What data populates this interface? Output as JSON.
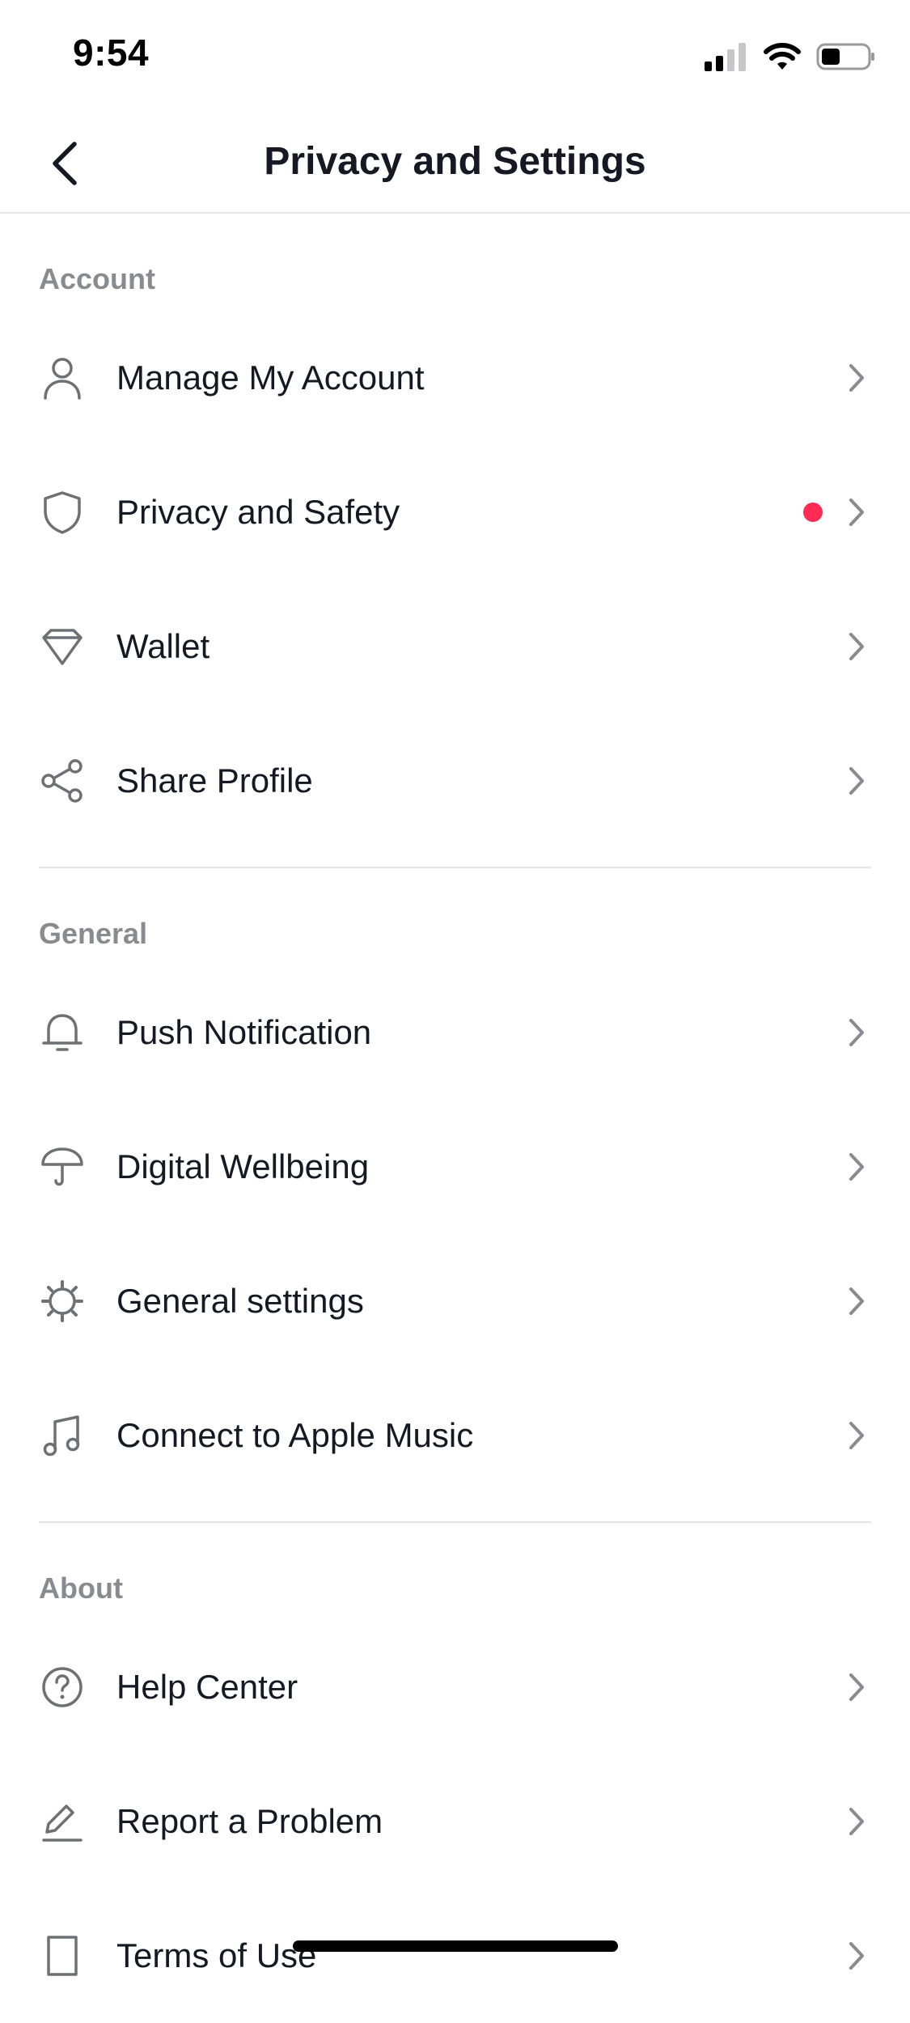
{
  "status_bar": {
    "time": "9:54"
  },
  "nav": {
    "title": "Privacy and Settings"
  },
  "sections": {
    "account": {
      "header": "Account",
      "items": [
        {
          "label": "Manage My Account",
          "icon": "person-icon"
        },
        {
          "label": "Privacy and Safety",
          "icon": "shield-icon",
          "has_notification_dot": true
        },
        {
          "label": "Wallet",
          "icon": "diamond-icon"
        },
        {
          "label": "Share Profile",
          "icon": "share-icon"
        }
      ]
    },
    "general": {
      "header": "General",
      "items": [
        {
          "label": "Push Notification",
          "icon": "bell-icon"
        },
        {
          "label": "Digital Wellbeing",
          "icon": "umbrella-icon"
        },
        {
          "label": "General settings",
          "icon": "gear-icon"
        },
        {
          "label": "Connect to Apple Music",
          "icon": "music-note-icon"
        }
      ]
    },
    "about": {
      "header": "About",
      "items": [
        {
          "label": "Help Center",
          "icon": "help-circle-icon"
        },
        {
          "label": "Report a Problem",
          "icon": "pencil-icon"
        },
        {
          "label": "Terms of Use",
          "icon": "book-icon"
        }
      ]
    }
  },
  "colors": {
    "text_primary": "#161823",
    "text_secondary": "#8a8b91",
    "icon": "#6f7075",
    "notification_dot": "#fe2c55",
    "divider": "#e3e3e4"
  }
}
